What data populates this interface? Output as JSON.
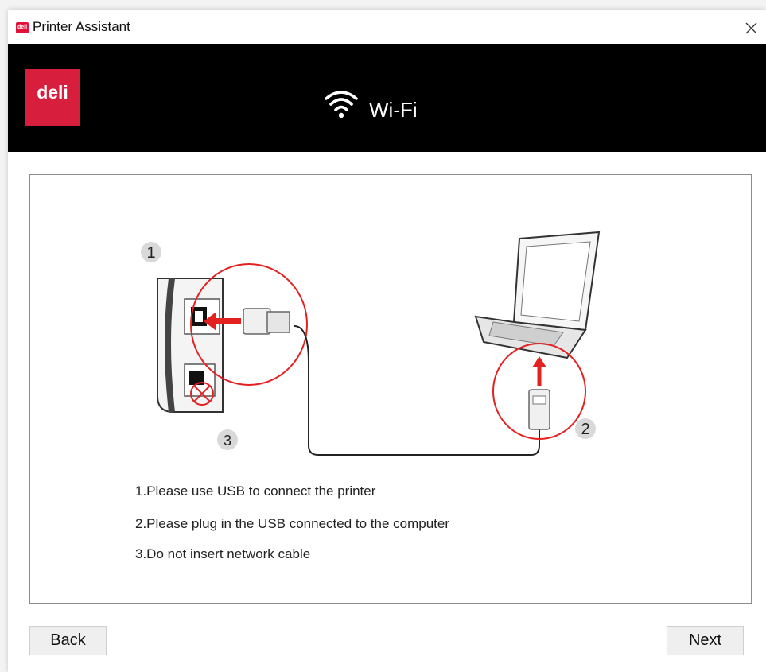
{
  "window": {
    "title": "Printer Assistant",
    "app_icon_text": "deli"
  },
  "header": {
    "logo_text": "deli",
    "title": "Wi-Fi",
    "icon": "wifi-icon",
    "background": "#000000",
    "logo_color": "#d81e3d"
  },
  "illustration": {
    "callouts": [
      "1",
      "2",
      "3"
    ]
  },
  "instructions": [
    "1.Please use USB to connect the printer",
    "2.Please plug in the USB connected to the computer",
    "3.Do not insert network cable"
  ],
  "buttons": {
    "back": "Back",
    "next": "Next"
  },
  "colors": {
    "accent_red": "#e0103a",
    "border": "#8c8c8c"
  }
}
